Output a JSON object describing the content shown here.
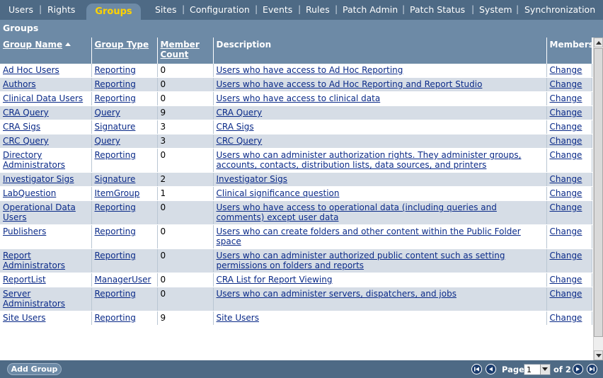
{
  "nav": {
    "tabs": [
      {
        "label": "Users"
      },
      {
        "label": "Rights"
      },
      {
        "label": "Groups"
      },
      {
        "label": "Sites"
      },
      {
        "label": "Configuration"
      },
      {
        "label": "Events"
      },
      {
        "label": "Rules"
      },
      {
        "label": "Patch Admin"
      },
      {
        "label": "Patch Status"
      },
      {
        "label": "System"
      },
      {
        "label": "Synchronization"
      }
    ],
    "active_tab": "Groups"
  },
  "section": {
    "title": "Groups"
  },
  "table": {
    "columns": {
      "group_name": "Group Name",
      "group_type": "Group Type",
      "member_count": "Member Count",
      "description": "Description",
      "members": "Members"
    },
    "rows": [
      {
        "name": "Ad Hoc Users",
        "type": "Reporting",
        "count": "0",
        "description": "Users who have access to Ad Hoc Reporting",
        "action": "Change"
      },
      {
        "name": "Authors",
        "type": "Reporting",
        "count": "0",
        "description": "Users who have access to Ad Hoc Reporting and Report Studio",
        "action": "Change"
      },
      {
        "name": "Clinical Data Users",
        "type": "Reporting",
        "count": "0",
        "description": "Users who have access to clinical data",
        "action": "Change"
      },
      {
        "name": "CRA Query",
        "type": "Query",
        "count": "9",
        "description": "CRA Query",
        "action": "Change"
      },
      {
        "name": "CRA Sigs",
        "type": "Signature",
        "count": "3",
        "description": "CRA Sigs",
        "action": "Change"
      },
      {
        "name": "CRC Query",
        "type": "Query",
        "count": "3",
        "description": "CRC Query",
        "action": "Change"
      },
      {
        "name": "Directory Administrators",
        "type": "Reporting",
        "count": "0",
        "description": "Users who can administer authorization rights. They administer groups, accounts, contacts, distribution lists, data sources, and printers",
        "action": "Change"
      },
      {
        "name": "Investigator Sigs",
        "type": "Signature",
        "count": "2",
        "description": "Investigator Sigs",
        "action": "Change"
      },
      {
        "name": "LabQuestion",
        "type": "ItemGroup",
        "count": "1",
        "description": "Clinical significance question",
        "action": "Change"
      },
      {
        "name": "Operational Data Users",
        "type": "Reporting",
        "count": "0",
        "description": "Users who have access to operational data (including queries and comments) except user data",
        "action": "Change"
      },
      {
        "name": "Publishers",
        "type": "Reporting",
        "count": "0",
        "description": "Users who can create folders and other content within the Public Folder space",
        "action": "Change"
      },
      {
        "name": "Report Administrators",
        "type": "Reporting",
        "count": "0",
        "description": "Users who can administer authorized public content such as setting permissions on folders and reports",
        "action": "Change"
      },
      {
        "name": "ReportList",
        "type": "ManagerUser",
        "count": "0",
        "description": "CRA List for Report Viewing",
        "action": "Change"
      },
      {
        "name": "Server Administrators",
        "type": "Reporting",
        "count": "0",
        "description": "Users who can administer servers, dispatchers, and jobs",
        "action": "Change"
      },
      {
        "name": "Site Users",
        "type": "Reporting",
        "count": "9",
        "description": "Site Users",
        "action": "Change"
      }
    ]
  },
  "footer": {
    "add_group_label": "Add Group",
    "page_label": "Page",
    "page_value": "1",
    "page_of": "of 2"
  },
  "colors": {
    "nav_bg": "#4e6a85",
    "header_bg": "#6d8aa6",
    "active_tab_text": "#ffd200",
    "row_alt": "#d6dde6",
    "link": "#0a2a88"
  }
}
